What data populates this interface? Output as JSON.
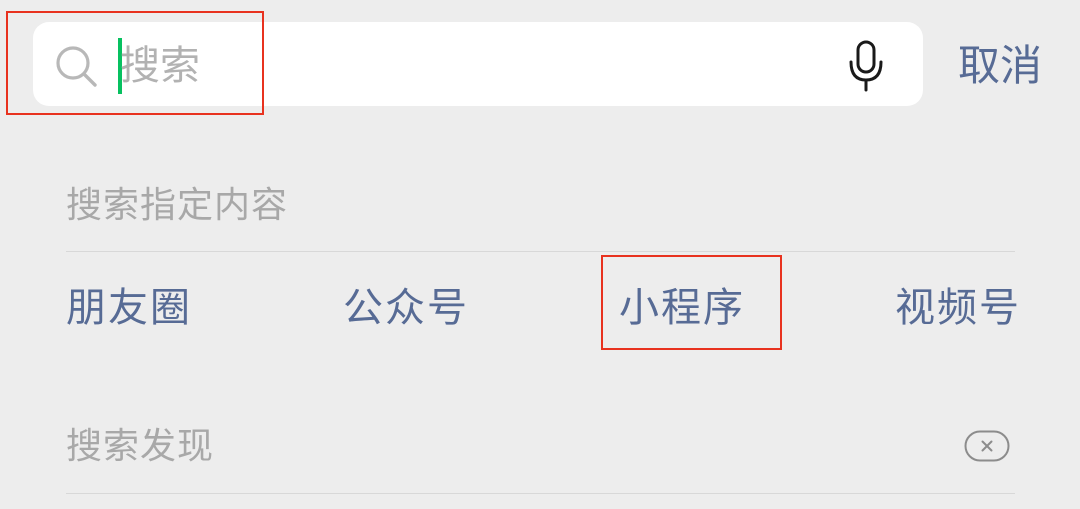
{
  "search": {
    "placeholder": "搜索",
    "cancel_label": "取消"
  },
  "specified_section": {
    "title": "搜索指定内容",
    "categories": [
      {
        "label": "朋友圈"
      },
      {
        "label": "公众号"
      },
      {
        "label": "小程序"
      },
      {
        "label": "视频号"
      }
    ]
  },
  "discover_section": {
    "title": "搜索发现"
  },
  "colors": {
    "accent": "#576b95",
    "cursor": "#07c160",
    "highlight": "#e8321f",
    "background": "#ededed"
  },
  "icons": [
    "search-icon",
    "microphone-icon",
    "clear-history-icon"
  ]
}
